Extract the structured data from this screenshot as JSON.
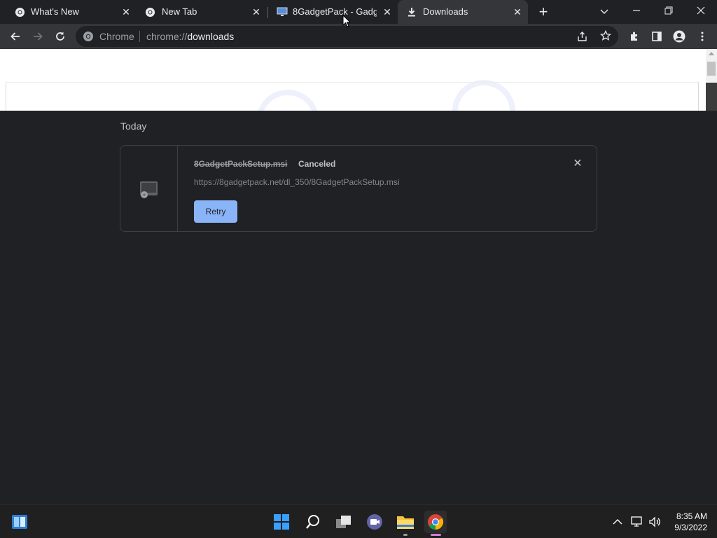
{
  "browser": {
    "tabs": [
      {
        "title": "What's New",
        "favicon": "chrome-icon",
        "active": false
      },
      {
        "title": "New Tab",
        "favicon": "chrome-icon",
        "active": false
      },
      {
        "title": "8GadgetPack - Gadgets",
        "favicon": "monitor-icon",
        "active": false
      },
      {
        "title": "Downloads",
        "favicon": "download-icon",
        "active": true
      }
    ],
    "omnibox": {
      "site_label": "Chrome",
      "url_prefix": "chrome://",
      "url_path": "downloads"
    }
  },
  "downloads": {
    "section_title": "Today",
    "items": [
      {
        "filename": "8GadgetPackSetup.msi",
        "status": "Canceled",
        "url": "https://8gadgetpack.net/dl_350/8GadgetPackSetup.msi",
        "action_label": "Retry"
      }
    ]
  },
  "taskbar": {
    "apps": [
      "widgets-icon",
      "start-icon",
      "search-icon",
      "task-view-icon",
      "chat-icon",
      "file-explorer-icon",
      "chrome-icon"
    ],
    "time": "8:35 AM",
    "date": "9/3/2022"
  },
  "colors": {
    "accent": "#8ab4f8",
    "page_bg": "#202124",
    "toolbar_bg": "#35363a"
  }
}
